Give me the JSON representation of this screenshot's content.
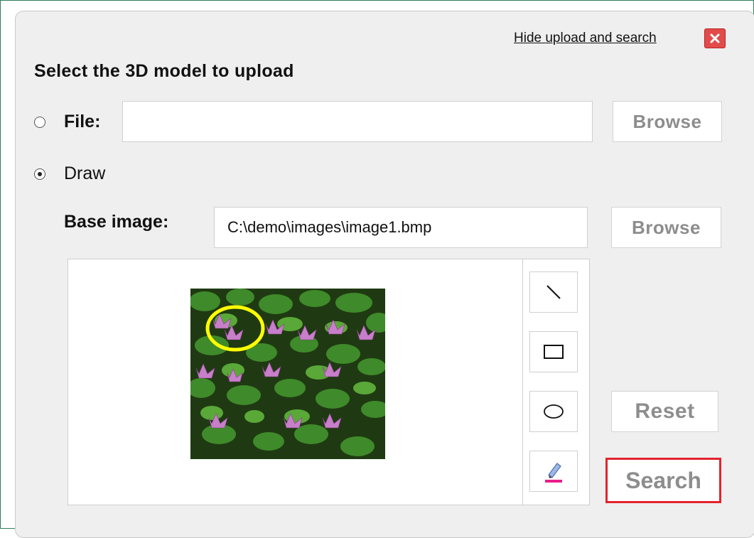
{
  "header": {
    "hide_link": "Hide upload and search",
    "close_icon": "close-icon",
    "title": "Select the 3D model to upload"
  },
  "file_option": {
    "label": "File:",
    "selected": false,
    "value": "",
    "browse_label": "Browse"
  },
  "draw_option": {
    "label": "Draw",
    "selected": true
  },
  "base_image": {
    "label": "Base image:",
    "value": "C:\\demo\\images\\image1.bmp",
    "browse_label": "Browse"
  },
  "tools": [
    {
      "name": "line-tool-icon"
    },
    {
      "name": "rectangle-tool-icon"
    },
    {
      "name": "ellipse-tool-icon"
    },
    {
      "name": "eraser-tool-icon"
    }
  ],
  "actions": {
    "reset_label": "Reset",
    "search_label": "Search"
  },
  "colors": {
    "close": "#e24b4b",
    "search_border": "#e3232d",
    "annotation": "#ffff00",
    "frame": "#2e7d5b"
  }
}
